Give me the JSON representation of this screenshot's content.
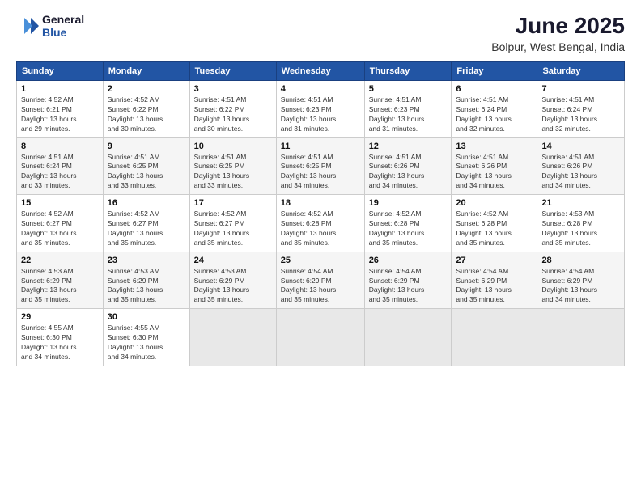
{
  "logo": {
    "line1": "General",
    "line2": "Blue"
  },
  "title": "June 2025",
  "subtitle": "Bolpur, West Bengal, India",
  "days_header": [
    "Sunday",
    "Monday",
    "Tuesday",
    "Wednesday",
    "Thursday",
    "Friday",
    "Saturday"
  ],
  "weeks": [
    [
      {
        "day": "1",
        "info": "Sunrise: 4:52 AM\nSunset: 6:21 PM\nDaylight: 13 hours\nand 29 minutes."
      },
      {
        "day": "2",
        "info": "Sunrise: 4:52 AM\nSunset: 6:22 PM\nDaylight: 13 hours\nand 30 minutes."
      },
      {
        "day": "3",
        "info": "Sunrise: 4:51 AM\nSunset: 6:22 PM\nDaylight: 13 hours\nand 30 minutes."
      },
      {
        "day": "4",
        "info": "Sunrise: 4:51 AM\nSunset: 6:23 PM\nDaylight: 13 hours\nand 31 minutes."
      },
      {
        "day": "5",
        "info": "Sunrise: 4:51 AM\nSunset: 6:23 PM\nDaylight: 13 hours\nand 31 minutes."
      },
      {
        "day": "6",
        "info": "Sunrise: 4:51 AM\nSunset: 6:24 PM\nDaylight: 13 hours\nand 32 minutes."
      },
      {
        "day": "7",
        "info": "Sunrise: 4:51 AM\nSunset: 6:24 PM\nDaylight: 13 hours\nand 32 minutes."
      }
    ],
    [
      {
        "day": "8",
        "info": "Sunrise: 4:51 AM\nSunset: 6:24 PM\nDaylight: 13 hours\nand 33 minutes."
      },
      {
        "day": "9",
        "info": "Sunrise: 4:51 AM\nSunset: 6:25 PM\nDaylight: 13 hours\nand 33 minutes."
      },
      {
        "day": "10",
        "info": "Sunrise: 4:51 AM\nSunset: 6:25 PM\nDaylight: 13 hours\nand 33 minutes."
      },
      {
        "day": "11",
        "info": "Sunrise: 4:51 AM\nSunset: 6:25 PM\nDaylight: 13 hours\nand 34 minutes."
      },
      {
        "day": "12",
        "info": "Sunrise: 4:51 AM\nSunset: 6:26 PM\nDaylight: 13 hours\nand 34 minutes."
      },
      {
        "day": "13",
        "info": "Sunrise: 4:51 AM\nSunset: 6:26 PM\nDaylight: 13 hours\nand 34 minutes."
      },
      {
        "day": "14",
        "info": "Sunrise: 4:51 AM\nSunset: 6:26 PM\nDaylight: 13 hours\nand 34 minutes."
      }
    ],
    [
      {
        "day": "15",
        "info": "Sunrise: 4:52 AM\nSunset: 6:27 PM\nDaylight: 13 hours\nand 35 minutes."
      },
      {
        "day": "16",
        "info": "Sunrise: 4:52 AM\nSunset: 6:27 PM\nDaylight: 13 hours\nand 35 minutes."
      },
      {
        "day": "17",
        "info": "Sunrise: 4:52 AM\nSunset: 6:27 PM\nDaylight: 13 hours\nand 35 minutes."
      },
      {
        "day": "18",
        "info": "Sunrise: 4:52 AM\nSunset: 6:28 PM\nDaylight: 13 hours\nand 35 minutes."
      },
      {
        "day": "19",
        "info": "Sunrise: 4:52 AM\nSunset: 6:28 PM\nDaylight: 13 hours\nand 35 minutes."
      },
      {
        "day": "20",
        "info": "Sunrise: 4:52 AM\nSunset: 6:28 PM\nDaylight: 13 hours\nand 35 minutes."
      },
      {
        "day": "21",
        "info": "Sunrise: 4:53 AM\nSunset: 6:28 PM\nDaylight: 13 hours\nand 35 minutes."
      }
    ],
    [
      {
        "day": "22",
        "info": "Sunrise: 4:53 AM\nSunset: 6:29 PM\nDaylight: 13 hours\nand 35 minutes."
      },
      {
        "day": "23",
        "info": "Sunrise: 4:53 AM\nSunset: 6:29 PM\nDaylight: 13 hours\nand 35 minutes."
      },
      {
        "day": "24",
        "info": "Sunrise: 4:53 AM\nSunset: 6:29 PM\nDaylight: 13 hours\nand 35 minutes."
      },
      {
        "day": "25",
        "info": "Sunrise: 4:54 AM\nSunset: 6:29 PM\nDaylight: 13 hours\nand 35 minutes."
      },
      {
        "day": "26",
        "info": "Sunrise: 4:54 AM\nSunset: 6:29 PM\nDaylight: 13 hours\nand 35 minutes."
      },
      {
        "day": "27",
        "info": "Sunrise: 4:54 AM\nSunset: 6:29 PM\nDaylight: 13 hours\nand 35 minutes."
      },
      {
        "day": "28",
        "info": "Sunrise: 4:54 AM\nSunset: 6:29 PM\nDaylight: 13 hours\nand 34 minutes."
      }
    ],
    [
      {
        "day": "29",
        "info": "Sunrise: 4:55 AM\nSunset: 6:30 PM\nDaylight: 13 hours\nand 34 minutes."
      },
      {
        "day": "30",
        "info": "Sunrise: 4:55 AM\nSunset: 6:30 PM\nDaylight: 13 hours\nand 34 minutes."
      },
      null,
      null,
      null,
      null,
      null
    ]
  ]
}
